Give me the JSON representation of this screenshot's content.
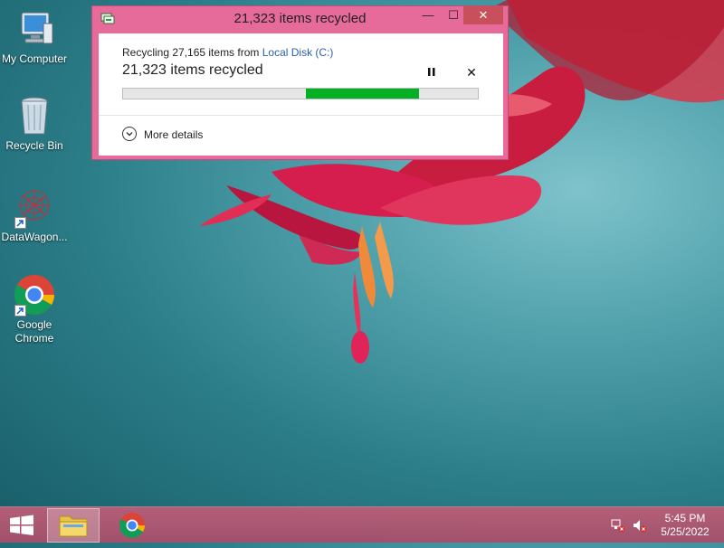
{
  "desktop": {
    "icons": [
      {
        "label": "My Computer",
        "icon": "computer-icon"
      },
      {
        "label": "Recycle Bin",
        "icon": "recycle-bin-icon"
      },
      {
        "label": "DataWagon...",
        "icon": "datawagon-icon"
      },
      {
        "label": "Google Chrome",
        "icon": "chrome-icon"
      }
    ]
  },
  "dialog": {
    "title": "21,323 items recycled",
    "minimize_label": "—",
    "maximize_label": "☐",
    "close_label": "✕",
    "source_prefix": "Recycling 27,165 items from ",
    "source_link": "Local Disk (C:)",
    "status": "21,323 items recycled",
    "pause_icon": "pause-icon",
    "cancel_label": "✕",
    "progress": {
      "processed_fraction": 0.515,
      "done_fraction": 0.835,
      "fill_color": "#06b025"
    },
    "more_details": "More details"
  },
  "taskbar": {
    "start_icon": "windows-start-icon",
    "pinned": [
      "file-explorer-icon",
      "chrome-icon"
    ],
    "tray": [
      "network-error-icon",
      "volume-muted-icon"
    ],
    "clock_time": "5:45 PM",
    "clock_date": "5/25/2022"
  }
}
